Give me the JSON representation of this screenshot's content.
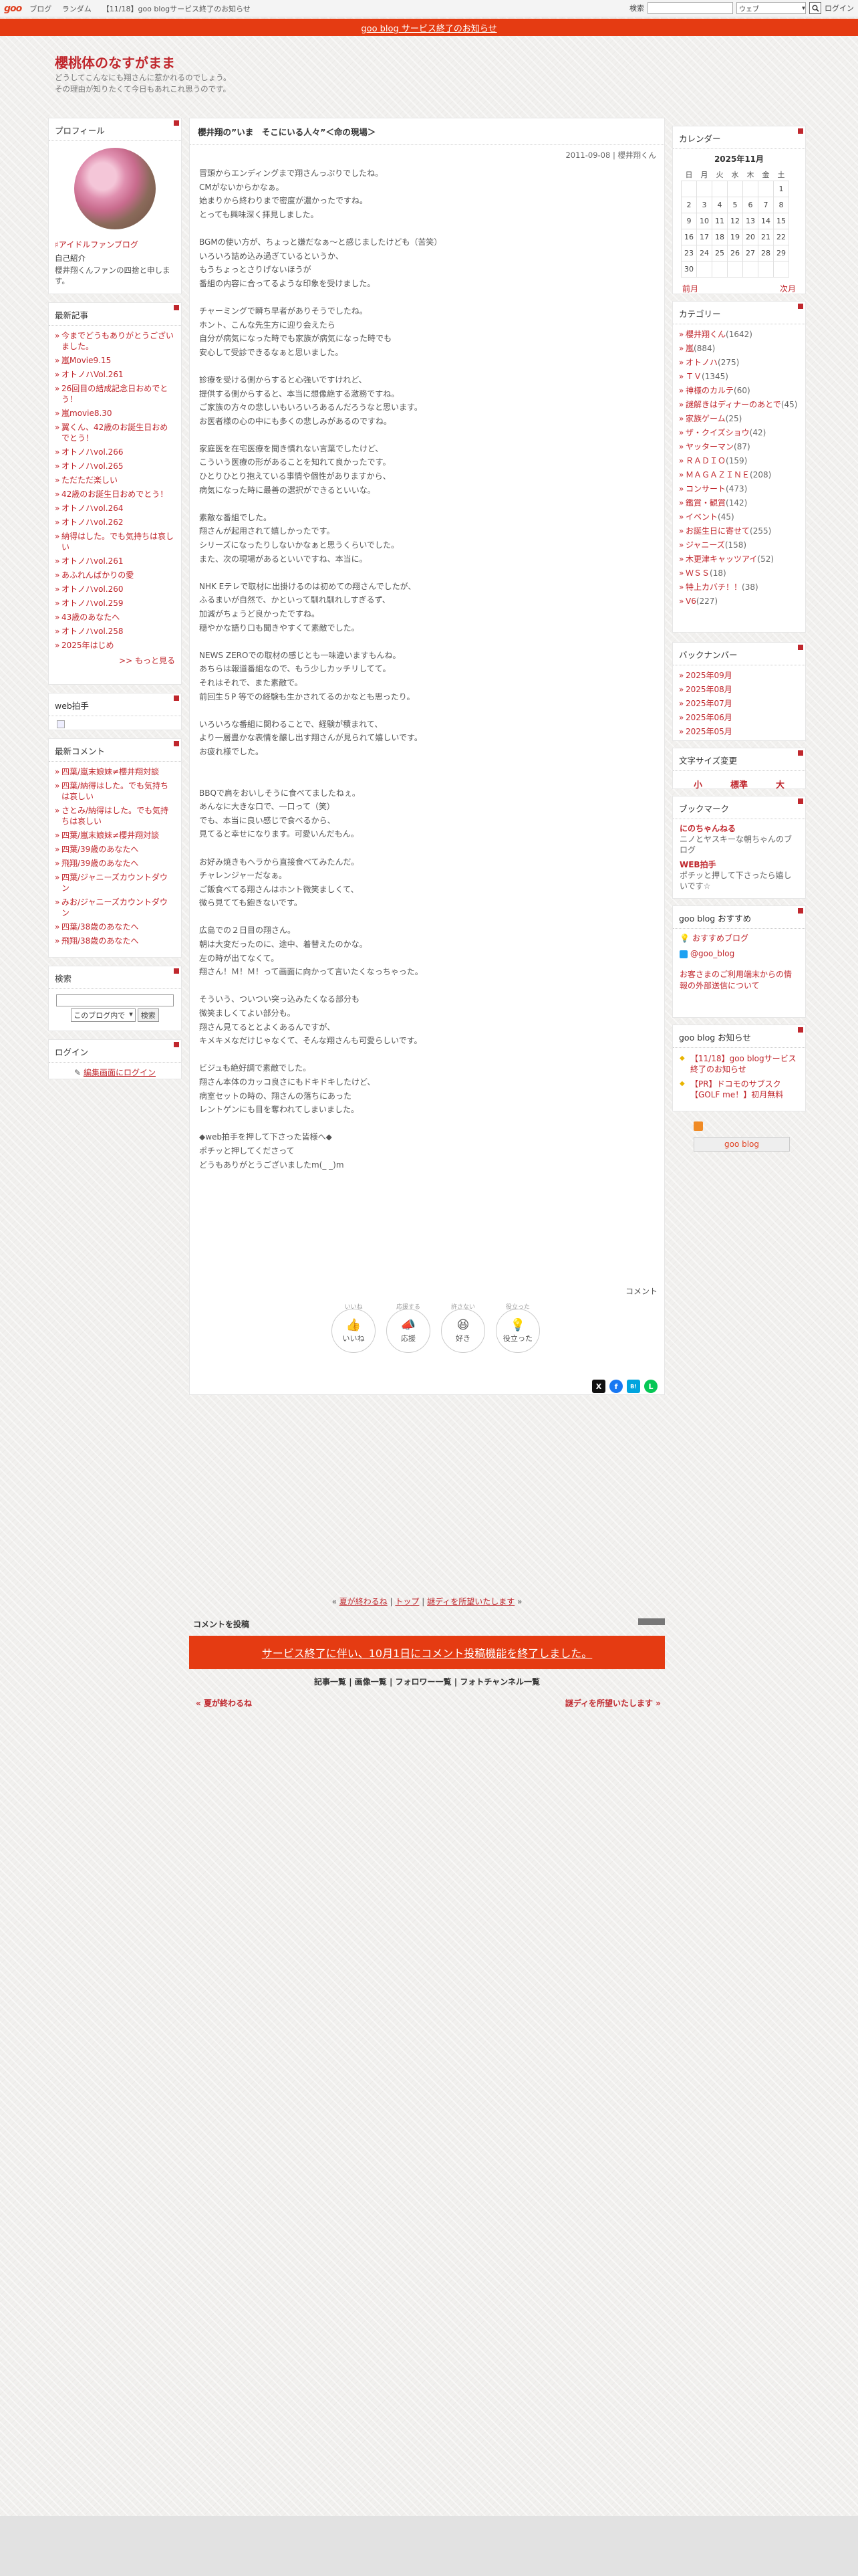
{
  "topbar": {
    "brand": "goo",
    "nav": [
      "ブログ",
      "ランダム"
    ],
    "news": "【11/18】goo blogサービス終了のお知らせ",
    "search_label": "検索",
    "search_select": "ウェブ",
    "login": "ログイン"
  },
  "notice": {
    "text": "goo blog サービス終了のお知らせ"
  },
  "blog": {
    "title": "櫻桃体のなすがまま",
    "desc_line1": "どうしてこんなにも翔さんに惹かれるのでしょう。",
    "desc_line2": "その理由が知りたくて今日もあれこれ思うのです。"
  },
  "profile": {
    "heading": "プロフィール",
    "fan": "♯アイドルファンブログ",
    "intro_heading": "自己紹介",
    "intro_text": "櫻井翔くんファンの四捨と申します。"
  },
  "recent": {
    "heading": "最新記事",
    "items": [
      "今までどうもありがとうございました。",
      "嵐Movie9.15",
      "オトノハVol.261",
      "26回目の結成記念日おめでとう！",
      "嵐movie8.30",
      "翼くん、42歳のお誕生日おめでとう！",
      "オトノハvol.266",
      "オトノハvol.265",
      "ただただ楽しい",
      "42歳のお誕生日おめでとう！",
      "オトノハvol.264",
      "オトノハvol.262",
      "納得はした。でも気持ちは哀しい",
      "オトノハvol.261",
      "あふれんばかりの愛",
      "オトノハvol.260",
      "オトノハvol.259",
      "43歳のあなたへ",
      "オトノハvol.258",
      "2025年はじめ"
    ],
    "more": ">> もっと見る"
  },
  "webclap": {
    "heading": "web拍手"
  },
  "comments": {
    "heading": "最新コメント",
    "items": [
      "四葉/嵐末娘妹≠櫻井翔対談",
      "四葉/納得はした。でも気持ちは哀しい",
      "さとみ/納得はした。でも気持ちは哀しい",
      "四葉/嵐末娘妹≠櫻井翔対談",
      "四葉/39歳のあなたへ",
      "飛翔/39歳のあなたへ",
      "四葉/ジャニーズカウントダウン",
      "みお/ジャニーズカウントダウン",
      "四葉/38歳のあなたへ",
      "飛翔/38歳のあなたへ"
    ]
  },
  "search": {
    "heading": "検索",
    "scope": "このブログ内で",
    "button": "検索"
  },
  "login": {
    "heading": "ログイン",
    "link": "編集画面にログイン"
  },
  "article": {
    "title": "櫻井翔の”いま　そこにいる人々”＜命の現場＞",
    "date": "2011-09-08 | 櫻井翔くん",
    "paragraphs": [
      [
        "冒頭からエンディングまで翔さんっぷりでしたね。",
        "CMがないからかなぁ。",
        "始まりから終わりまで密度が濃かったですね。",
        "とっても興味深く拝見しました。"
      ],
      [
        "BGMの使い方が、ちょっと嫌だなぁ～と感じましたけども（苦笑）",
        "いろいろ詰め込み過ぎているというか、",
        "もうちょっとさりげないほうが",
        "番組の内容に合ってるような印象を受けました。"
      ],
      [
        "チャーミングで瞬ち早者がありそうでしたね。",
        "ホント、こんな先生方に迎り会えたら",
        "自分が病気になった時でも家族が病気になった時でも",
        "安心して受診できるなぁと思いました。"
      ],
      [
        "診療を受ける側からすると心強いですけれど、",
        "提供する側からすると、本当に想像絶する激務ですね。",
        "ご家族の方々の悲しいもいろいろあるんだろうなと思います。",
        "お医者様の心の中にも多くの悲しみがあるのですね。"
      ],
      [
        "家庭医を在宅医療を聞き慣れない言葉でしたけど、",
        "こういう医療の形があることを知れて良かったです。",
        "ひとりひとり抱えている事情や個性がありますから、",
        "病気になった時に最善の選択ができるといいな。"
      ],
      [
        "素敵な番組でした。",
        "翔さんが起用されて嬉しかったです。",
        "シリーズになったりしないかなぁと思うくらいでした。",
        "また、次の現場があるといいですね、本当に。"
      ],
      [
        "NHK Eテレで取材に出掛けるのは初めての翔さんでしたが、",
        "ふるまいが自然で、かといって馴れ馴れしすぎるず、",
        "加減がちょうど良かったですね。",
        "穏やかな語り口も聞きやすくて素敵でした。"
      ],
      [
        "NEWS ZEROでの取材の感じとも一味違いますもんね。",
        "あちらは報道番組なので、もう少しカッチリしてて。",
        "それはそれで、また素敵で。",
        "前回生５P 等での経験も生かされてるのかなとも思ったり。"
      ],
      [
        "いろいろな番組に関わることで、経験が積まれて、",
        "より一層豊かな表情を醸し出す翔さんが見られて嬉しいです。",
        "お疲れ様でした。"
      ],
      [],
      [
        "BBQで肩をおいしそうに食べてましたねぇ。",
        "あんなに大きな口で、一口って（笑）",
        "でも、本当に良い感じで食べるから、",
        "見てると幸せになります。可愛いんだもん。"
      ],
      [
        "お好み焼きもヘラから直接食べてみたんだ。",
        "チャレンジャーだなぁ。",
        "ご飯食べてる翔さんはホント微笑ましくて、",
        "微ら見てても飽きないです。"
      ],
      [
        "広島での２日目の翔さん。",
        "朝は大変だったのに、途中、着替えたのかな。",
        "左の時が出てなくて。",
        "翔さん！Ｍ！Ｍ！って画面に向かって言いたくなっちゃった。"
      ],
      [
        "そういう、ついつい突っ込みたくなる部分も",
        "微笑ましくてよい部分も。",
        "翔さん見てるととよくあるんですが、",
        "キメキメなだけじゃなくて、そんな翔さんも可愛らしいです。"
      ],
      [
        "ビジュも絶好調で素敵でした。",
        "翔さん本体のカッコ良さにもドキドキしたけど、",
        "病室セットの時の、翔さんの落ちにあった",
        "レントゲンにも目を奪われてしまいました。"
      ],
      [
        "◆web拍手を押して下さった皆様へ◆",
        "ポチッと押してくださって",
        "どうもありがとうございましたm(_ _)m"
      ]
    ],
    "comment_label": "コメント"
  },
  "reactions": [
    {
      "label": "いいね",
      "tiny": "いいね",
      "icon": "👍"
    },
    {
      "label": "応援",
      "tiny": "応援する",
      "icon": "📣"
    },
    {
      "label": "許さ",
      "tiny": "許さない",
      "icon": "😆"
    },
    {
      "label": "役立った",
      "tiny": "役立った",
      "icon": "💡"
    }
  ],
  "reaction_labels": {
    "like": "いいね",
    "cheer": "応援",
    "funny": "好き",
    "useful": "役立った"
  },
  "share": {
    "x": "X",
    "fb": "f",
    "hatena": "B!",
    "line": "L"
  },
  "postnav": {
    "prev": "夏が終わるね",
    "top": "トップ",
    "next": "謎ディを所望いたします"
  },
  "comment_post": {
    "heading": "コメントを投稿",
    "closed": "サービス終了に伴い、10月1日にコメント投稿機能を終了しました。"
  },
  "lists": {
    "a": "記事一覧",
    "b": "画像一覧",
    "c": "フォロワー一覧",
    "d": "フォトチャンネル一覧"
  },
  "calendar": {
    "heading": "カレンダー",
    "month": "2025年11月",
    "days": [
      "日",
      "月",
      "火",
      "水",
      "木",
      "金",
      "土"
    ],
    "rows": [
      [
        "",
        "",
        "",
        "",
        "",
        "",
        "1"
      ],
      [
        "2",
        "3",
        "4",
        "5",
        "6",
        "7",
        "8"
      ],
      [
        "9",
        "10",
        "11",
        "12",
        "13",
        "14",
        "15"
      ],
      [
        "16",
        "17",
        "18",
        "19",
        "20",
        "21",
        "22"
      ],
      [
        "23",
        "24",
        "25",
        "26",
        "27",
        "28",
        "29"
      ],
      [
        "30",
        "",
        "",
        "",
        "",
        "",
        ""
      ]
    ],
    "prev": "前月",
    "next": "次月"
  },
  "categories": {
    "heading": "カテゴリー",
    "items": [
      [
        "櫻井翔くん",
        "(1642)"
      ],
      [
        "嵐",
        "(884)"
      ],
      [
        "オトノハ",
        "(275)"
      ],
      [
        "ＴＶ",
        "(1345)"
      ],
      [
        "神様のカルテ",
        "(60)"
      ],
      [
        "謎解きはディナーのあとで",
        "(45)"
      ],
      [
        "家族ゲーム",
        "(25)"
      ],
      [
        "ザ・クイズショウ",
        "(42)"
      ],
      [
        "ヤッターマン",
        "(87)"
      ],
      [
        "ＲＡＤＩＯ",
        "(159)"
      ],
      [
        "ＭＡＧＡＺＩＮＥ",
        "(208)"
      ],
      [
        "コンサート",
        "(473)"
      ],
      [
        "鑑賞・観賞",
        "(142)"
      ],
      [
        "イベント",
        "(45)"
      ],
      [
        "お誕生日に寄せて",
        "(255)"
      ],
      [
        "ジャニーズ",
        "(158)"
      ],
      [
        "木更津キャッツアイ",
        "(52)"
      ],
      [
        "ＷＳＳ",
        "(18)"
      ],
      [
        "特上カバチ！！",
        "(38)"
      ],
      [
        "V6",
        "(227)"
      ]
    ]
  },
  "backnumber": {
    "heading": "バックナンバー",
    "items": [
      "2025年09月",
      "2025年08月",
      "2025年07月",
      "2025年06月",
      "2025年05月"
    ]
  },
  "fontsize": {
    "heading": "文字サイズ変更",
    "small": "小",
    "mid": "標準",
    "large": "大"
  },
  "bookmark": {
    "heading": "ブックマーク",
    "items": [
      {
        "t": "にのちゃんねる",
        "d": "ニノとヤスキーな朝ちゃんのブログ"
      },
      {
        "t": "WEB拍手",
        "d": "ポチッと押して下さったら嬉しいです☆"
      }
    ]
  },
  "recommend": {
    "heading": "goo blog おすすめ",
    "a": "おすすめブログ",
    "b": "@goo_blog",
    "notice": "お客さまのご利用端末からの情報の外部送信について"
  },
  "gooinfo": {
    "heading": "goo blog お知らせ",
    "items": [
      "【11/18】goo blogサービス終了のお知らせ",
      "【PR】ドコモのサブスク【GOLF me！】初月無料"
    ]
  },
  "footer_badge": "goo blog"
}
